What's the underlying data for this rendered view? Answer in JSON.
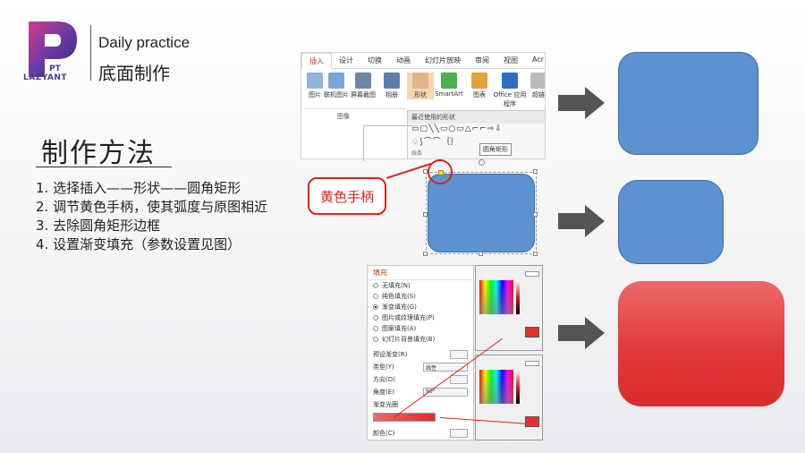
{
  "brand": {
    "logo_text": "LAZYANT",
    "logo_sub": "PT",
    "title_en": "Daily practice",
    "title_cn": "底面制作"
  },
  "method": {
    "title": "制作方法",
    "steps": [
      "1.  选择插入——形状——圆角矩形",
      "2.  调节黄色手柄，使其弧度与原图相近",
      "3.  去除圆角矩形边框",
      "4.  设置渐变填充（参数设置见图）"
    ]
  },
  "ribbon": {
    "tabs": [
      "插入",
      "设计",
      "切换",
      "动画",
      "幻灯片放映",
      "审阅",
      "视图",
      "Acr"
    ],
    "tools": [
      "图片",
      "联机图片",
      "屏幕截图",
      "相册",
      "形状",
      "SmartArt",
      "图表",
      "Office 应用程序",
      "超链"
    ],
    "group_label": "图像",
    "shape_panel_title": "最近使用的形状",
    "shape_row1": "▭▢╲╲▭○▭△⌐⌐⇨⇩",
    "shape_row2": "♢⟆⌒⌒｛｝",
    "lines_label": "线条",
    "tooltip": "圆角矩形"
  },
  "callout": {
    "label": "黄色手柄"
  },
  "fill_panel": {
    "header": "填充",
    "options": [
      "无填充(N)",
      "纯色填充(S)",
      "渐变填充(G)",
      "图片或纹理填充(P)",
      "图案填充(A)",
      "幻灯片背景填充(B)"
    ],
    "selected_index": 2,
    "props": {
      "preset_label": "预设渐变(R)",
      "type_label": "类型(Y)",
      "type_value": "线性",
      "direction_label": "方向(D)",
      "angle_label": "角度(E)",
      "angle_value": "90°",
      "stops_label": "渐变光圈",
      "color_label": "颜色(C)"
    }
  },
  "colors": {
    "blue_fill": "#5b92cf",
    "blue_border": "#3f6ea6",
    "red_top": "#ec6a6a",
    "red_bottom": "#d82d2e",
    "callout_red": "#d9241c",
    "arrow_gray": "#555555"
  },
  "icons": [
    "logo-p-icon",
    "right-arrow-icon"
  ]
}
